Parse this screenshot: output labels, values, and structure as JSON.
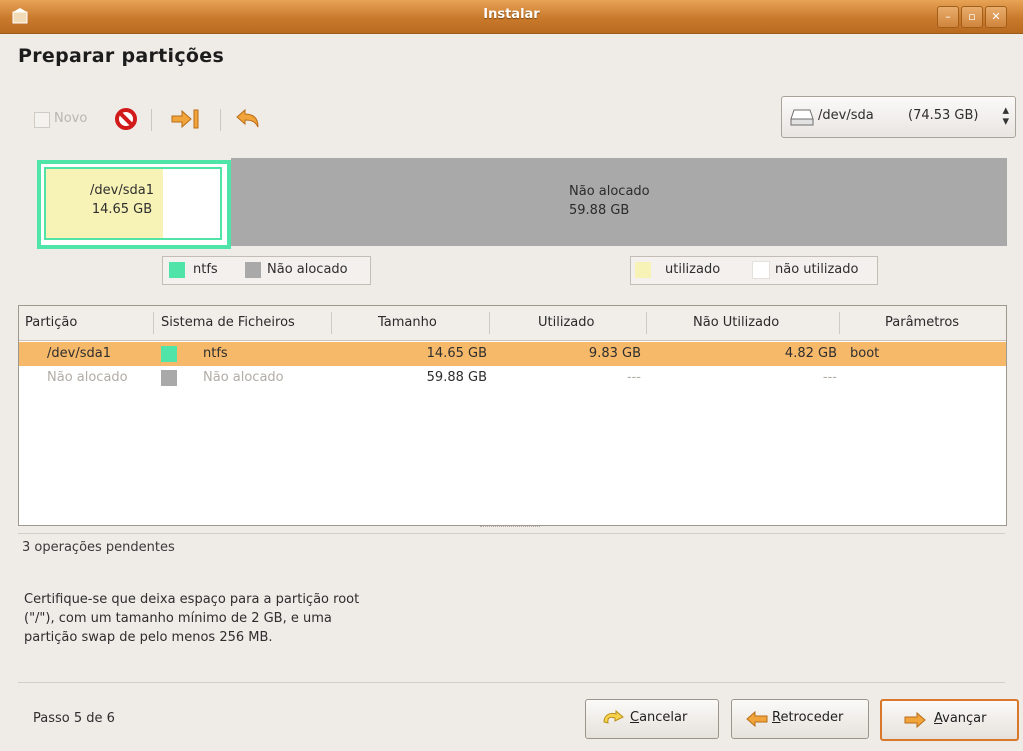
{
  "window": {
    "title": "Instalar"
  },
  "page": {
    "title": "Preparar partições"
  },
  "toolbar": {
    "new_label": "Novo"
  },
  "device": {
    "name": "/dev/sda",
    "size": "(74.53 GB)"
  },
  "partition_bar": {
    "sda1": {
      "name": "/dev/sda1",
      "size": "14.65 GB",
      "used_fraction": 0.67
    },
    "free": {
      "name": "Não alocado",
      "size": "59.88 GB"
    }
  },
  "legend_fs": [
    {
      "label": "ntfs",
      "color": "#50e4a8"
    },
    {
      "label": "Não alocado",
      "color": "#a9a9a9"
    }
  ],
  "legend_usage": [
    {
      "label": "utilizado",
      "color": "#f7f3b6"
    },
    {
      "label": "não utilizado",
      "color": "#ffffff"
    }
  ],
  "table": {
    "headers": [
      "Partição",
      "Sistema de Ficheiros",
      "Tamanho",
      "Utilizado",
      "Não Utilizado",
      "Parâmetros"
    ],
    "rows": [
      {
        "partition": "/dev/sda1",
        "fs": "ntfs",
        "fs_color": "#50e4a8",
        "size": "14.65 GB",
        "used": "9.83 GB",
        "unused": "4.82 GB",
        "params": "boot"
      },
      {
        "partition": "Não alocado",
        "fs": "Não alocado",
        "fs_color": "#a9a9a9",
        "size": "59.88 GB",
        "used": "---",
        "unused": "---",
        "params": ""
      }
    ]
  },
  "pending": "3 operações pendentes",
  "info": [
    "Certifique-se que deixa espaço para a partição root",
    "(\"/\"), com um tamanho mínimo de 2 GB, e uma",
    "partição swap de pelo menos 256 MB."
  ],
  "footer": {
    "step": "Passo 5 de 6",
    "cancel_first": "C",
    "cancel_rest": "ancelar",
    "back_first": "R",
    "back_rest": "etroceder",
    "forward_first": "A",
    "forward_rest": "vançar"
  }
}
